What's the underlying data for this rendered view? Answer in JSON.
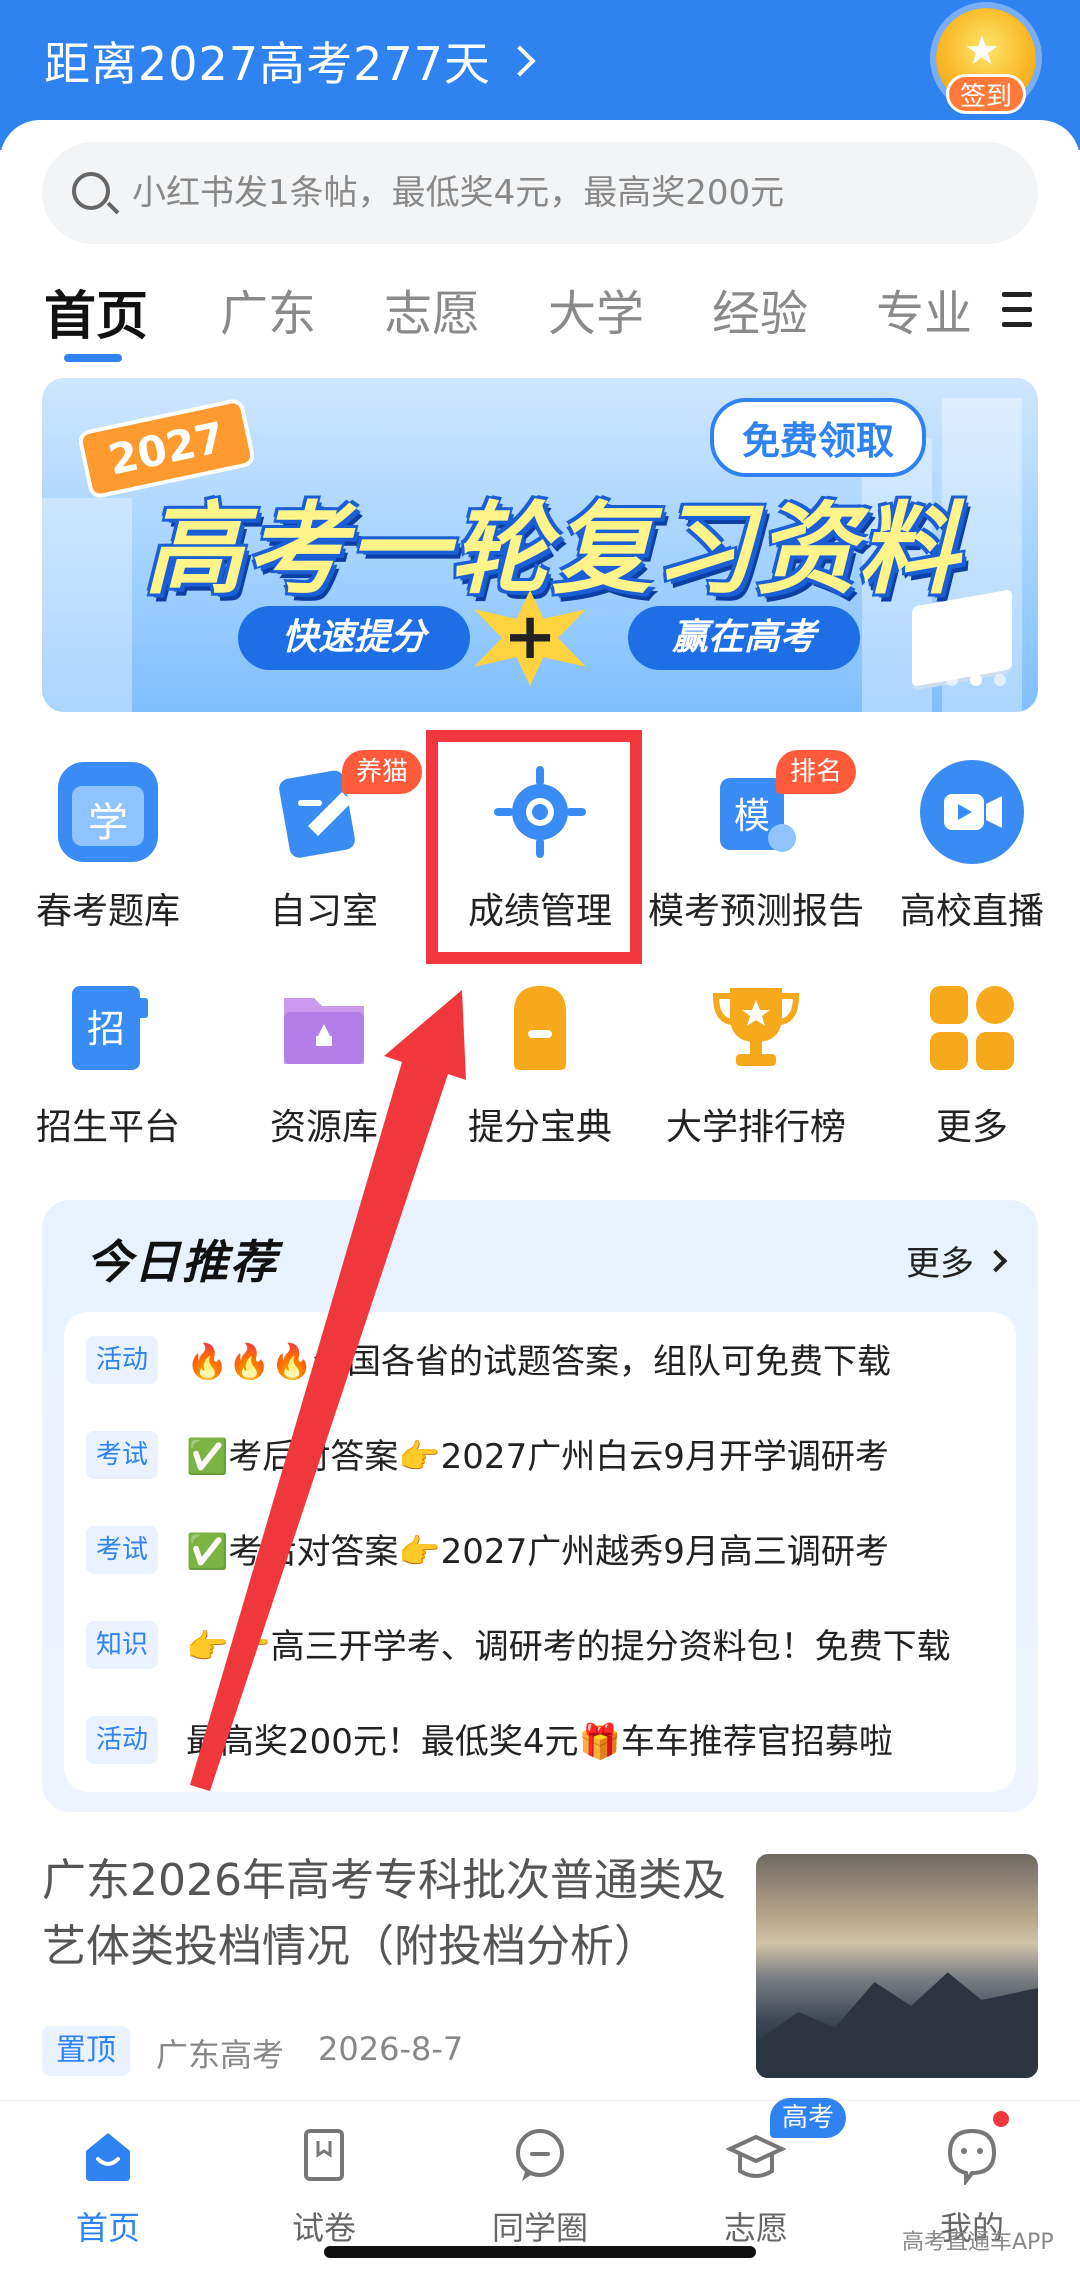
{
  "header": {
    "countdown_text": "距离2027高考277天",
    "checkin_label": "签到"
  },
  "search": {
    "placeholder": "小红书发1条帖，最低奖4元，最高奖200元"
  },
  "tabs": [
    {
      "label": "首页",
      "active": true
    },
    {
      "label": "广东"
    },
    {
      "label": "志愿"
    },
    {
      "label": "大学"
    },
    {
      "label": "经验"
    },
    {
      "label": "专业"
    }
  ],
  "banner": {
    "year": "2027",
    "free_label": "免费领取",
    "title": "高考一轮复习资料",
    "left_pill": "快速提分",
    "plus": "+",
    "right_pill": "赢在高考"
  },
  "grid": [
    {
      "label": "春考题库",
      "icon": "question-bank-icon"
    },
    {
      "label": "自习室",
      "icon": "study-room-icon",
      "badge": "养猫"
    },
    {
      "label": "成绩管理",
      "icon": "score-target-icon"
    },
    {
      "label": "模考预测报告",
      "icon": "mock-exam-icon",
      "badge": "排名",
      "icon_text": "模"
    },
    {
      "label": "高校直播",
      "icon": "live-video-icon"
    },
    {
      "label": "招生平台",
      "icon": "admissions-icon",
      "icon_text": "招"
    },
    {
      "label": "资源库",
      "icon": "folder-icon"
    },
    {
      "label": "提分宝典",
      "icon": "backpack-icon"
    },
    {
      "label": "大学排行榜",
      "icon": "trophy-icon"
    },
    {
      "label": "更多",
      "icon": "more-grid-icon"
    }
  ],
  "icon_glyphs": {
    "question_bank": "学"
  },
  "recommend": {
    "title": "今日推荐",
    "more_label": "更多",
    "items": [
      {
        "tag": "活动",
        "text": "🔥🔥🔥全国各省的试题答案，组队可免费下载"
      },
      {
        "tag": "考试",
        "text": "✅考后对答案👉2027广州白云9月开学调研考"
      },
      {
        "tag": "考试",
        "text": "✅考后对答案👉2027广州越秀9月高三调研考"
      },
      {
        "tag": "知识",
        "text": "👉👉高三开学考、调研考的提分资料包！免费下载"
      },
      {
        "tag": "活动",
        "text": "最高奖200元！最低奖4元🎁车车推荐官招募啦"
      }
    ]
  },
  "news": {
    "title": "广东2026年高考专科批次普通类及艺体类投档情况（附投档分析）",
    "pin": "置顶",
    "source": "广东高考",
    "date": "2026-8-7"
  },
  "bottom_nav": [
    {
      "label": "首页",
      "active": true
    },
    {
      "label": "试卷"
    },
    {
      "label": "同学圈"
    },
    {
      "label": "志愿"
    },
    {
      "label": "我的"
    }
  ],
  "bottom_badge": "高考",
  "watermark": "高考直通车APP",
  "colors": {
    "primary": "#2f83f0",
    "highlight": "#f0383c",
    "badge": "#ff5a3a"
  }
}
